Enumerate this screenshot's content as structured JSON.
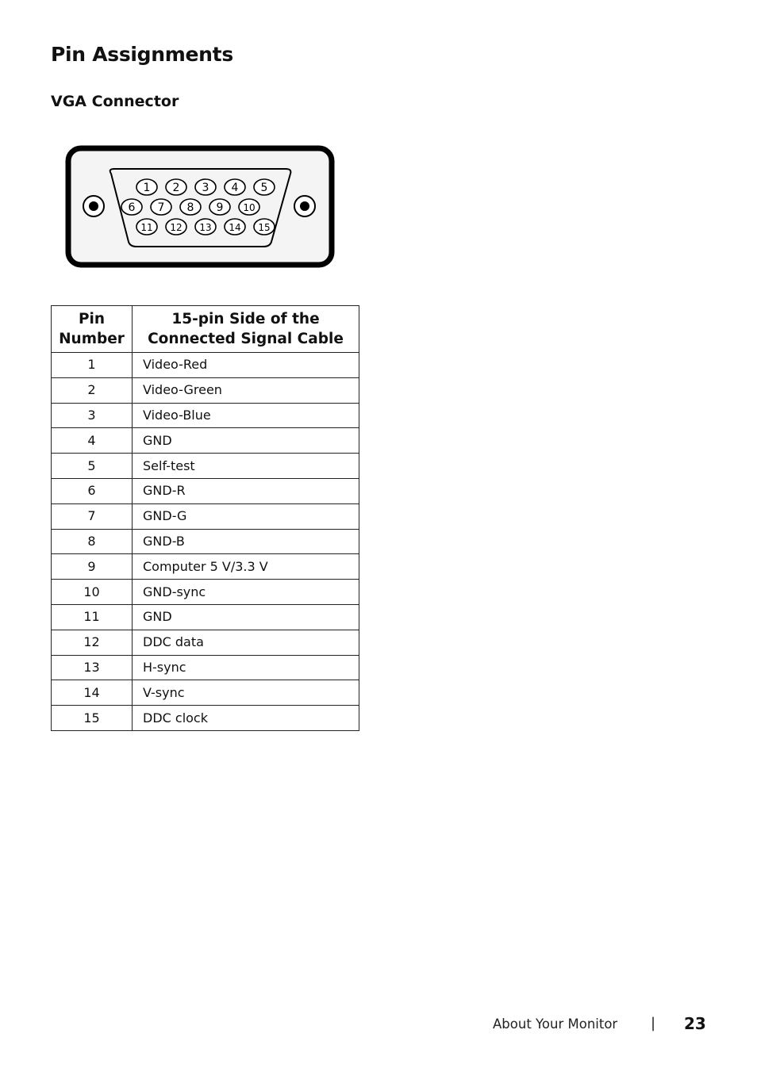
{
  "page": {
    "title": "Pin Assignments",
    "section_title": "VGA Connector"
  },
  "connector": {
    "name": "VGA D-sub 15-pin",
    "pins_row1": [
      "1",
      "2",
      "3",
      "4",
      "5"
    ],
    "pins_row2": [
      "6",
      "7",
      "8",
      "9",
      "10"
    ],
    "pins_row3": [
      "11",
      "12",
      "13",
      "14",
      "15"
    ]
  },
  "table": {
    "headers": {
      "pin": "Pin Number",
      "signal": "15-pin Side of the Connected Signal Cable"
    },
    "rows": [
      {
        "pin": "1",
        "signal": "Video-Red"
      },
      {
        "pin": "2",
        "signal": "Video-Green"
      },
      {
        "pin": "3",
        "signal": "Video-Blue"
      },
      {
        "pin": "4",
        "signal": "GND"
      },
      {
        "pin": "5",
        "signal": "Self-test"
      },
      {
        "pin": "6",
        "signal": "GND-R"
      },
      {
        "pin": "7",
        "signal": "GND-G"
      },
      {
        "pin": "8",
        "signal": "GND-B"
      },
      {
        "pin": "9",
        "signal": "Computer 5 V/3.3 V"
      },
      {
        "pin": "10",
        "signal": "GND-sync"
      },
      {
        "pin": "11",
        "signal": "GND"
      },
      {
        "pin": "12",
        "signal": "DDC data"
      },
      {
        "pin": "13",
        "signal": "H-sync"
      },
      {
        "pin": "14",
        "signal": "V-sync"
      },
      {
        "pin": "15",
        "signal": "DDC clock"
      }
    ]
  },
  "footer": {
    "section": "About Your Monitor",
    "separator": "|",
    "page_number": "23"
  }
}
